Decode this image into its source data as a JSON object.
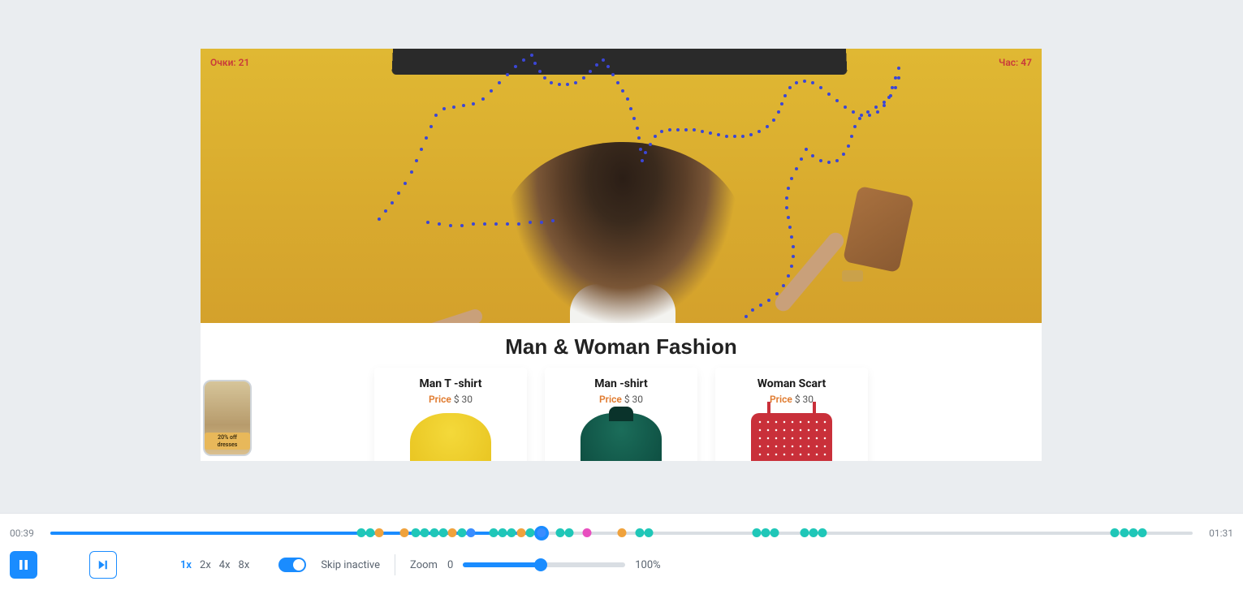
{
  "recording": {
    "corner_left": "Очки: 21",
    "corner_right": "Час: 47",
    "section_title": "Man & Woman Fashion",
    "products": [
      {
        "name": "Man T -shirt",
        "price_label": "Price",
        "price_value": "$ 30"
      },
      {
        "name": "Man -shirt",
        "price_label": "Price",
        "price_value": "$ 30"
      },
      {
        "name": "Woman Scart",
        "price_label": "Price",
        "price_value": "$ 30"
      }
    ],
    "mini_badge": "20% off\ndresses"
  },
  "player": {
    "current_time": "00:39",
    "total_time": "01:31",
    "progress_pct": 43,
    "speeds": [
      "1x",
      "2x",
      "4x",
      "8x"
    ],
    "active_speed": "1x",
    "skip_label": "Skip inactive",
    "zoom_label": "Zoom",
    "zoom_min": "0",
    "zoom_max": "100%",
    "zoom_pct": 48,
    "events": [
      {
        "pct": 27.2,
        "cls": "ev-teal"
      },
      {
        "pct": 28.0,
        "cls": "ev-teal"
      },
      {
        "pct": 28.8,
        "cls": "ev-orange"
      },
      {
        "pct": 31.0,
        "cls": "ev-orange"
      },
      {
        "pct": 32.0,
        "cls": "ev-teal"
      },
      {
        "pct": 32.8,
        "cls": "ev-teal"
      },
      {
        "pct": 33.6,
        "cls": "ev-teal"
      },
      {
        "pct": 34.4,
        "cls": "ev-teal"
      },
      {
        "pct": 35.2,
        "cls": "ev-orange"
      },
      {
        "pct": 36.0,
        "cls": "ev-teal"
      },
      {
        "pct": 36.8,
        "cls": "ev-blue"
      },
      {
        "pct": 38.8,
        "cls": "ev-teal"
      },
      {
        "pct": 39.6,
        "cls": "ev-teal"
      },
      {
        "pct": 40.4,
        "cls": "ev-teal"
      },
      {
        "pct": 41.2,
        "cls": "ev-orange"
      },
      {
        "pct": 42.0,
        "cls": "ev-teal"
      },
      {
        "pct": 43.0,
        "cls": "ev-blue"
      },
      {
        "pct": 44.6,
        "cls": "ev-teal"
      },
      {
        "pct": 45.4,
        "cls": "ev-teal"
      },
      {
        "pct": 47.0,
        "cls": "ev-pink"
      },
      {
        "pct": 50.0,
        "cls": "ev-orange"
      },
      {
        "pct": 51.6,
        "cls": "ev-teal"
      },
      {
        "pct": 52.4,
        "cls": "ev-teal"
      },
      {
        "pct": 61.8,
        "cls": "ev-teal"
      },
      {
        "pct": 62.6,
        "cls": "ev-teal"
      },
      {
        "pct": 63.4,
        "cls": "ev-teal"
      },
      {
        "pct": 66.0,
        "cls": "ev-teal"
      },
      {
        "pct": 66.8,
        "cls": "ev-teal"
      },
      {
        "pct": 67.6,
        "cls": "ev-teal"
      },
      {
        "pct": 93.2,
        "cls": "ev-teal"
      },
      {
        "pct": 94.0,
        "cls": "ev-teal"
      },
      {
        "pct": 94.8,
        "cls": "ev-teal"
      },
      {
        "pct": 95.6,
        "cls": "ev-teal"
      }
    ]
  }
}
